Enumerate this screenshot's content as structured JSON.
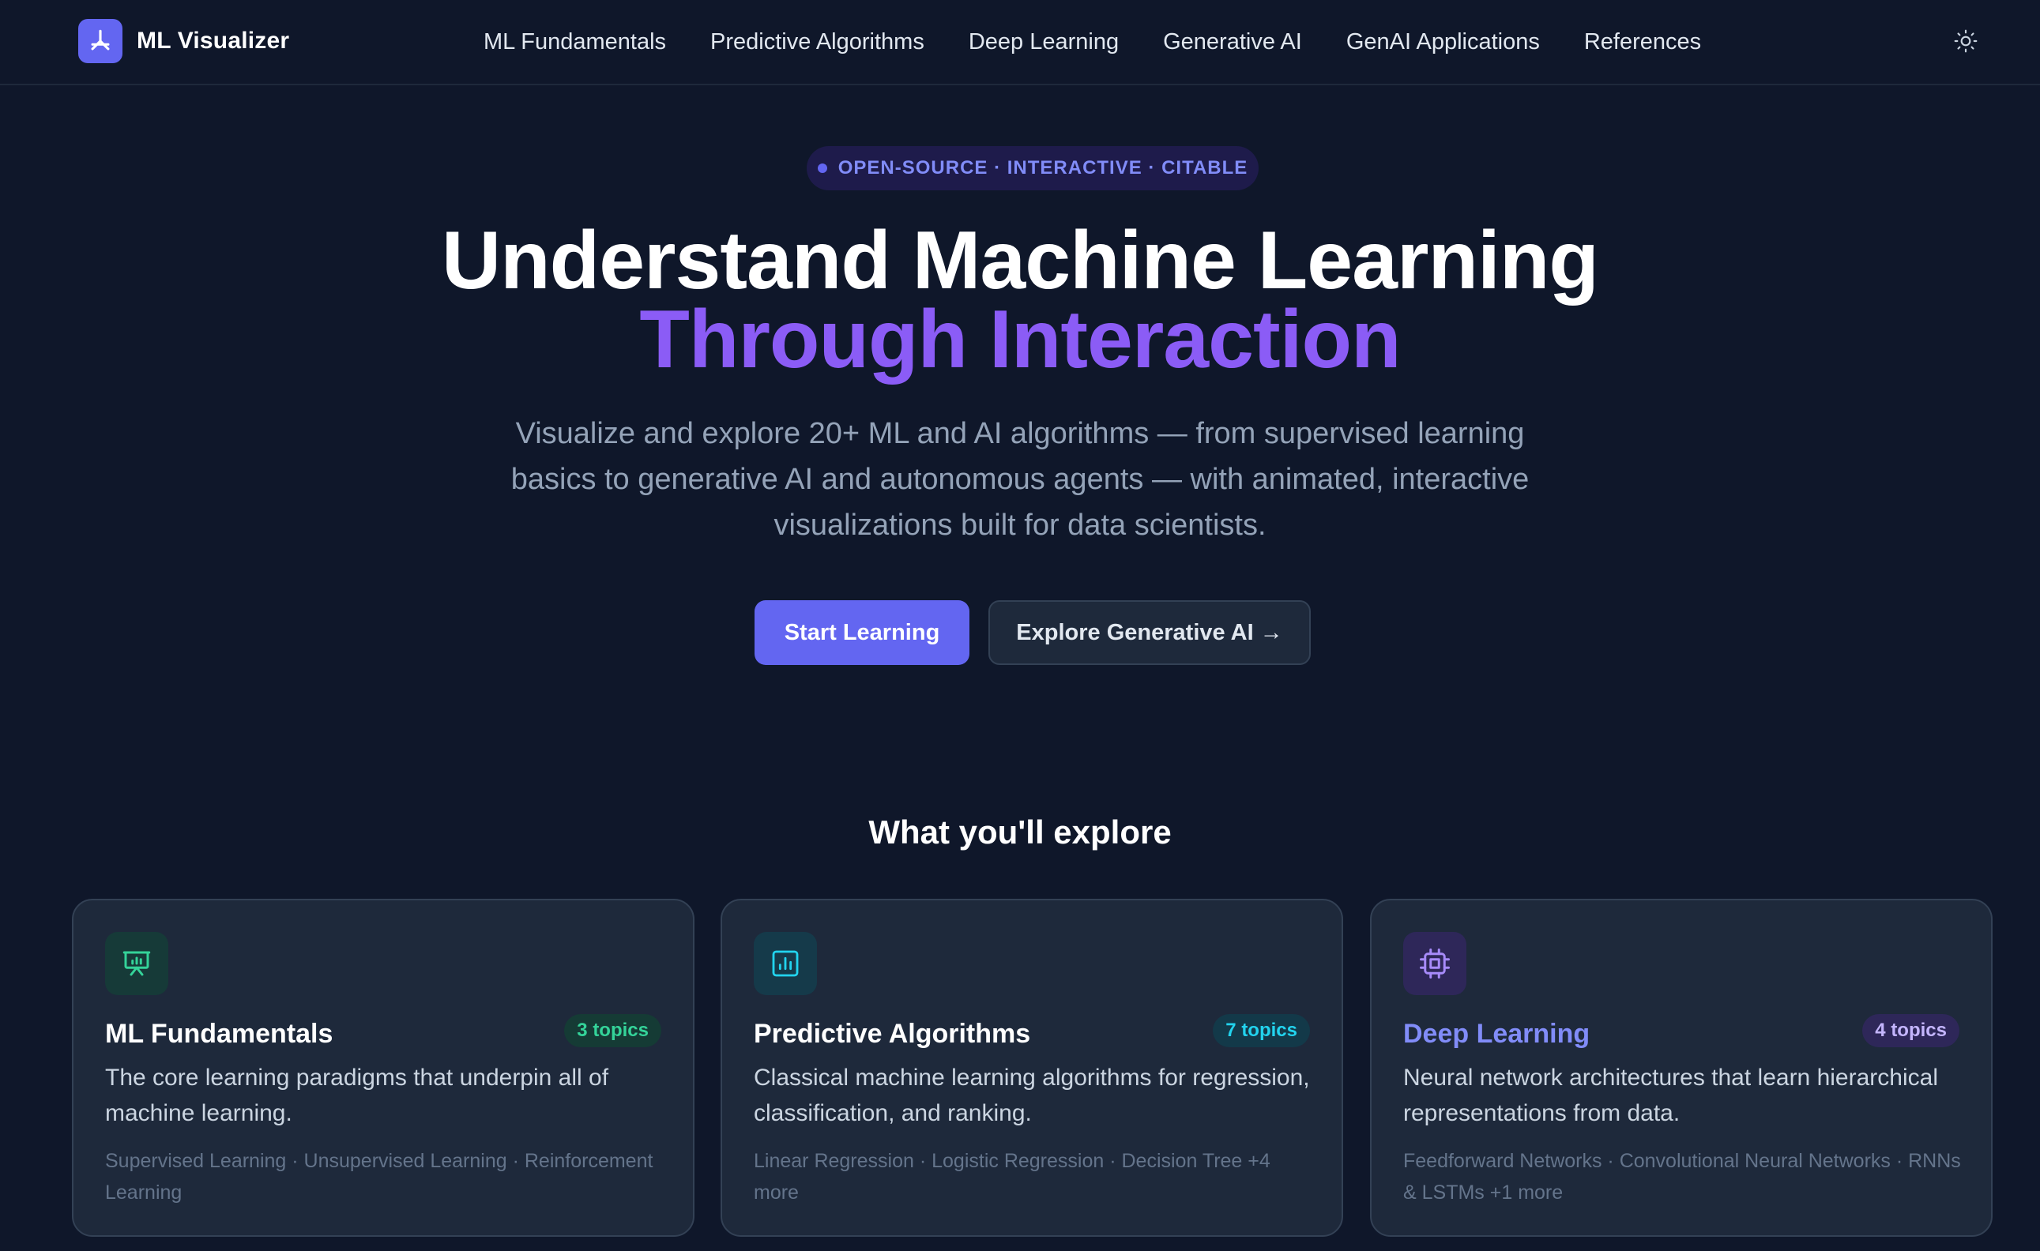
{
  "brand": {
    "name": "ML Visualizer",
    "icon": "model-icon",
    "color": "#6366f1"
  },
  "nav": {
    "links": [
      "ML Fundamentals",
      "Predictive Algorithms",
      "Deep Learning",
      "Generative AI",
      "GenAI Applications",
      "References"
    ],
    "theme_icon": "sun-icon"
  },
  "hero": {
    "badge": "OPEN-SOURCE · INTERACTIVE · CITABLE",
    "title_line1": "Understand Machine Learning",
    "title_line2": "Through Interaction",
    "subtitle": "Visualize and explore 20+ ML and AI algorithms — from supervised learning basics to generative AI and autonomous agents — with animated, interactive visualizations built for data scientists.",
    "primary_button": "Start Learning",
    "secondary_button": "Explore Generative AI →"
  },
  "explore": {
    "title": "What you'll explore",
    "cards": [
      {
        "title": "ML Fundamentals",
        "badge": "3 topics",
        "description": "The core learning paradigms that underpin all of machine learning.",
        "topics": "Supervised Learning · Unsupervised Learning · Reinforcement Learning",
        "icon": "presentation-chart-icon",
        "color": "#34d399"
      },
      {
        "title": "Predictive Algorithms",
        "badge": "7 topics",
        "description": "Classical machine learning algorithms for regression, classification, and ranking.",
        "topics": "Linear Regression · Logistic Regression · Decision Tree +4 more",
        "icon": "bar-chart-icon",
        "color": "#22d3ee"
      },
      {
        "title": "Deep Learning",
        "badge": "4 topics",
        "description": "Neural network architectures that learn hierarchical representations from data.",
        "topics": "Feedforward Networks · Convolutional Neural Networks · RNNs & LSTMs +1 more",
        "icon": "cpu-chip-icon",
        "color": "#a78bfa"
      }
    ]
  },
  "colors": {
    "background": "#0f172a",
    "card": "#1e293b",
    "accent": "#6366f1",
    "accent_purple": "#8b5cf6"
  }
}
